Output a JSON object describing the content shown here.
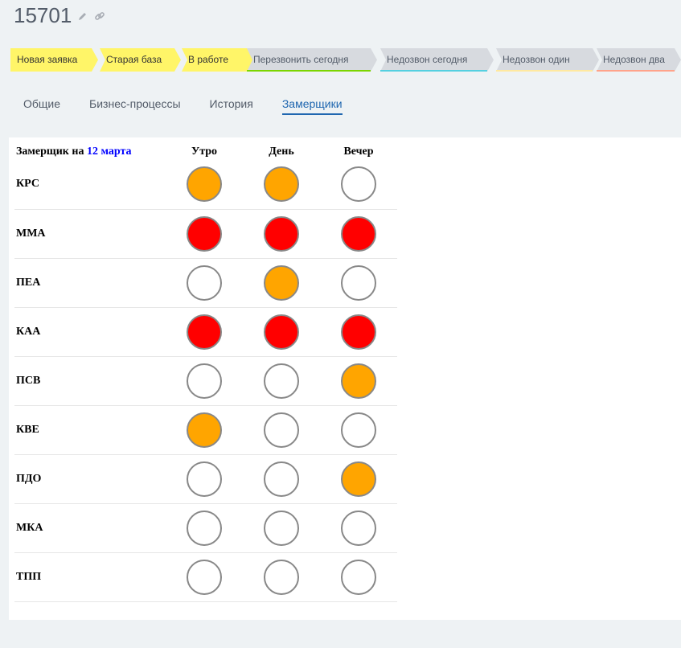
{
  "header": {
    "title": "15701",
    "edit_icon": "pencil-icon",
    "link_icon": "link-icon"
  },
  "stages": [
    {
      "label": "Новая заявка",
      "color": "#fff568",
      "active": true
    },
    {
      "label": "Старая база",
      "color": "#fff568",
      "active": true
    },
    {
      "label": "В работе",
      "color": "#fff568",
      "active": true
    },
    {
      "label": "Перезвонить сегодня",
      "color": "#d7dadf",
      "line": "#7bd500",
      "active": false
    },
    {
      "label": "Недозвон сегодня",
      "color": "#d7dadf",
      "line": "#55d0e0",
      "active": false
    },
    {
      "label": "Недозвон один",
      "color": "#d7dadf",
      "line": "#ffe9a0",
      "active": false
    },
    {
      "label": "Недозвон два",
      "color": "#d7dadf",
      "line": "#ffa38a",
      "active": false
    }
  ],
  "tabs": [
    {
      "label": "Общие",
      "active": false
    },
    {
      "label": "Бизнес-процессы",
      "active": false
    },
    {
      "label": "История",
      "active": false
    },
    {
      "label": "Замерщики",
      "active": true
    }
  ],
  "schedule": {
    "header_prefix": "Замерщик на",
    "header_date": "12 марта",
    "columns": [
      "Утро",
      "День",
      "Вечер"
    ],
    "status_colors": {
      "busy": "#ff0000",
      "partial": "#ffa500",
      "free": "#ffffff"
    },
    "rows": [
      {
        "name": "КРС",
        "slots": [
          "partial",
          "partial",
          "free"
        ]
      },
      {
        "name": "ММА",
        "slots": [
          "busy",
          "busy",
          "busy"
        ]
      },
      {
        "name": "ПЕА",
        "slots": [
          "free",
          "partial",
          "free"
        ]
      },
      {
        "name": "КАА",
        "slots": [
          "busy",
          "busy",
          "busy"
        ]
      },
      {
        "name": "ПСВ",
        "slots": [
          "free",
          "free",
          "partial"
        ]
      },
      {
        "name": "КВЕ",
        "slots": [
          "partial",
          "free",
          "free"
        ]
      },
      {
        "name": "ПДО",
        "slots": [
          "free",
          "free",
          "partial"
        ]
      },
      {
        "name": "МКА",
        "slots": [
          "free",
          "free",
          "free"
        ]
      },
      {
        "name": "ТПП",
        "slots": [
          "free",
          "free",
          "free"
        ]
      }
    ]
  }
}
